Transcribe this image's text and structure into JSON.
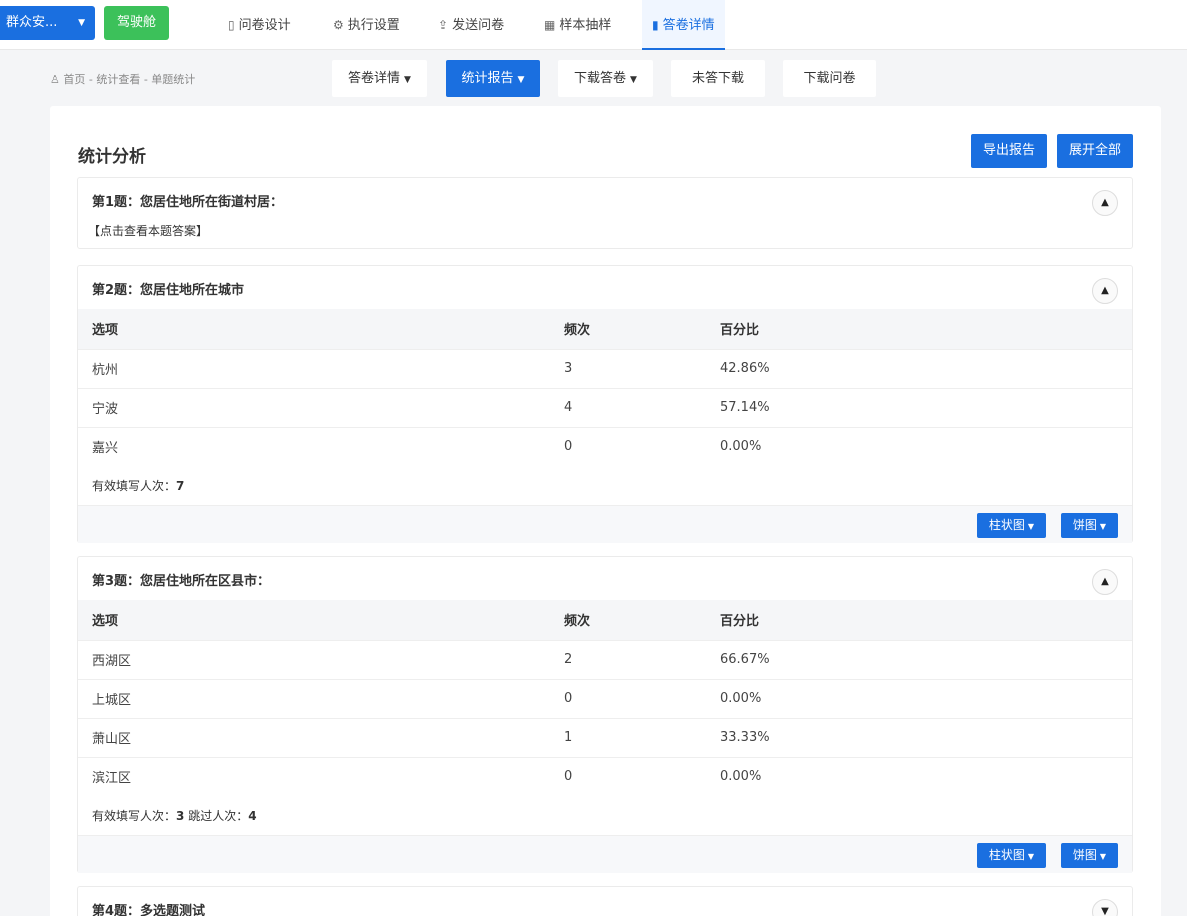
{
  "topnav": {
    "project_name": "群众安...",
    "cockpit_label": "驾驶舱",
    "tabs": [
      {
        "label": "问卷设计",
        "icon": "document-icon"
      },
      {
        "label": "执行设置",
        "icon": "gear-icon"
      },
      {
        "label": "发送问卷",
        "icon": "share-icon"
      },
      {
        "label": "样本抽样",
        "icon": "sample-icon"
      },
      {
        "label": "答卷详情",
        "icon": "bar-chart-icon",
        "active": true
      }
    ]
  },
  "breadcrumb": "首页 - 统计查看 - 单题统计",
  "subnav": {
    "answer_detail": "答卷详情",
    "stat_report": "统计报告",
    "download_answers": "下载答卷",
    "unanswered_download": "未答下载",
    "download_survey": "下载问卷"
  },
  "panel": {
    "title": "统计分析",
    "export_label": "导出报告",
    "expand_label": "展开全部"
  },
  "table_headers": {
    "option": "选项",
    "count": "频次",
    "percent": "百分比"
  },
  "chart_buttons": {
    "bar": "柱状图",
    "pie": "饼图"
  },
  "questions": [
    {
      "title": "第1题：您居住地所在街道村居：",
      "view_link": "【点击查看本题答案】"
    },
    {
      "title": "第2题：您居住地所在城市",
      "rows": [
        {
          "option": "杭州",
          "count": "3",
          "percent": "42.86%"
        },
        {
          "option": "宁波",
          "count": "4",
          "percent": "57.14%"
        },
        {
          "option": "嘉兴",
          "count": "0",
          "percent": "0.00%"
        }
      ],
      "valid_label": "有效填写人次：",
      "valid_value": "7"
    },
    {
      "title": "第3题：您居住地所在区县市：",
      "rows": [
        {
          "option": "西湖区",
          "count": "2",
          "percent": "66.67%"
        },
        {
          "option": "上城区",
          "count": "0",
          "percent": "0.00%"
        },
        {
          "option": "萧山区",
          "count": "1",
          "percent": "33.33%"
        },
        {
          "option": "滨江区",
          "count": "0",
          "percent": "0.00%"
        }
      ],
      "valid_label": "有效填写人次：",
      "valid_value": "3",
      "skip_label": "跳过人次：",
      "skip_value": "4"
    },
    {
      "title": "第4题：多选题测试"
    }
  ]
}
